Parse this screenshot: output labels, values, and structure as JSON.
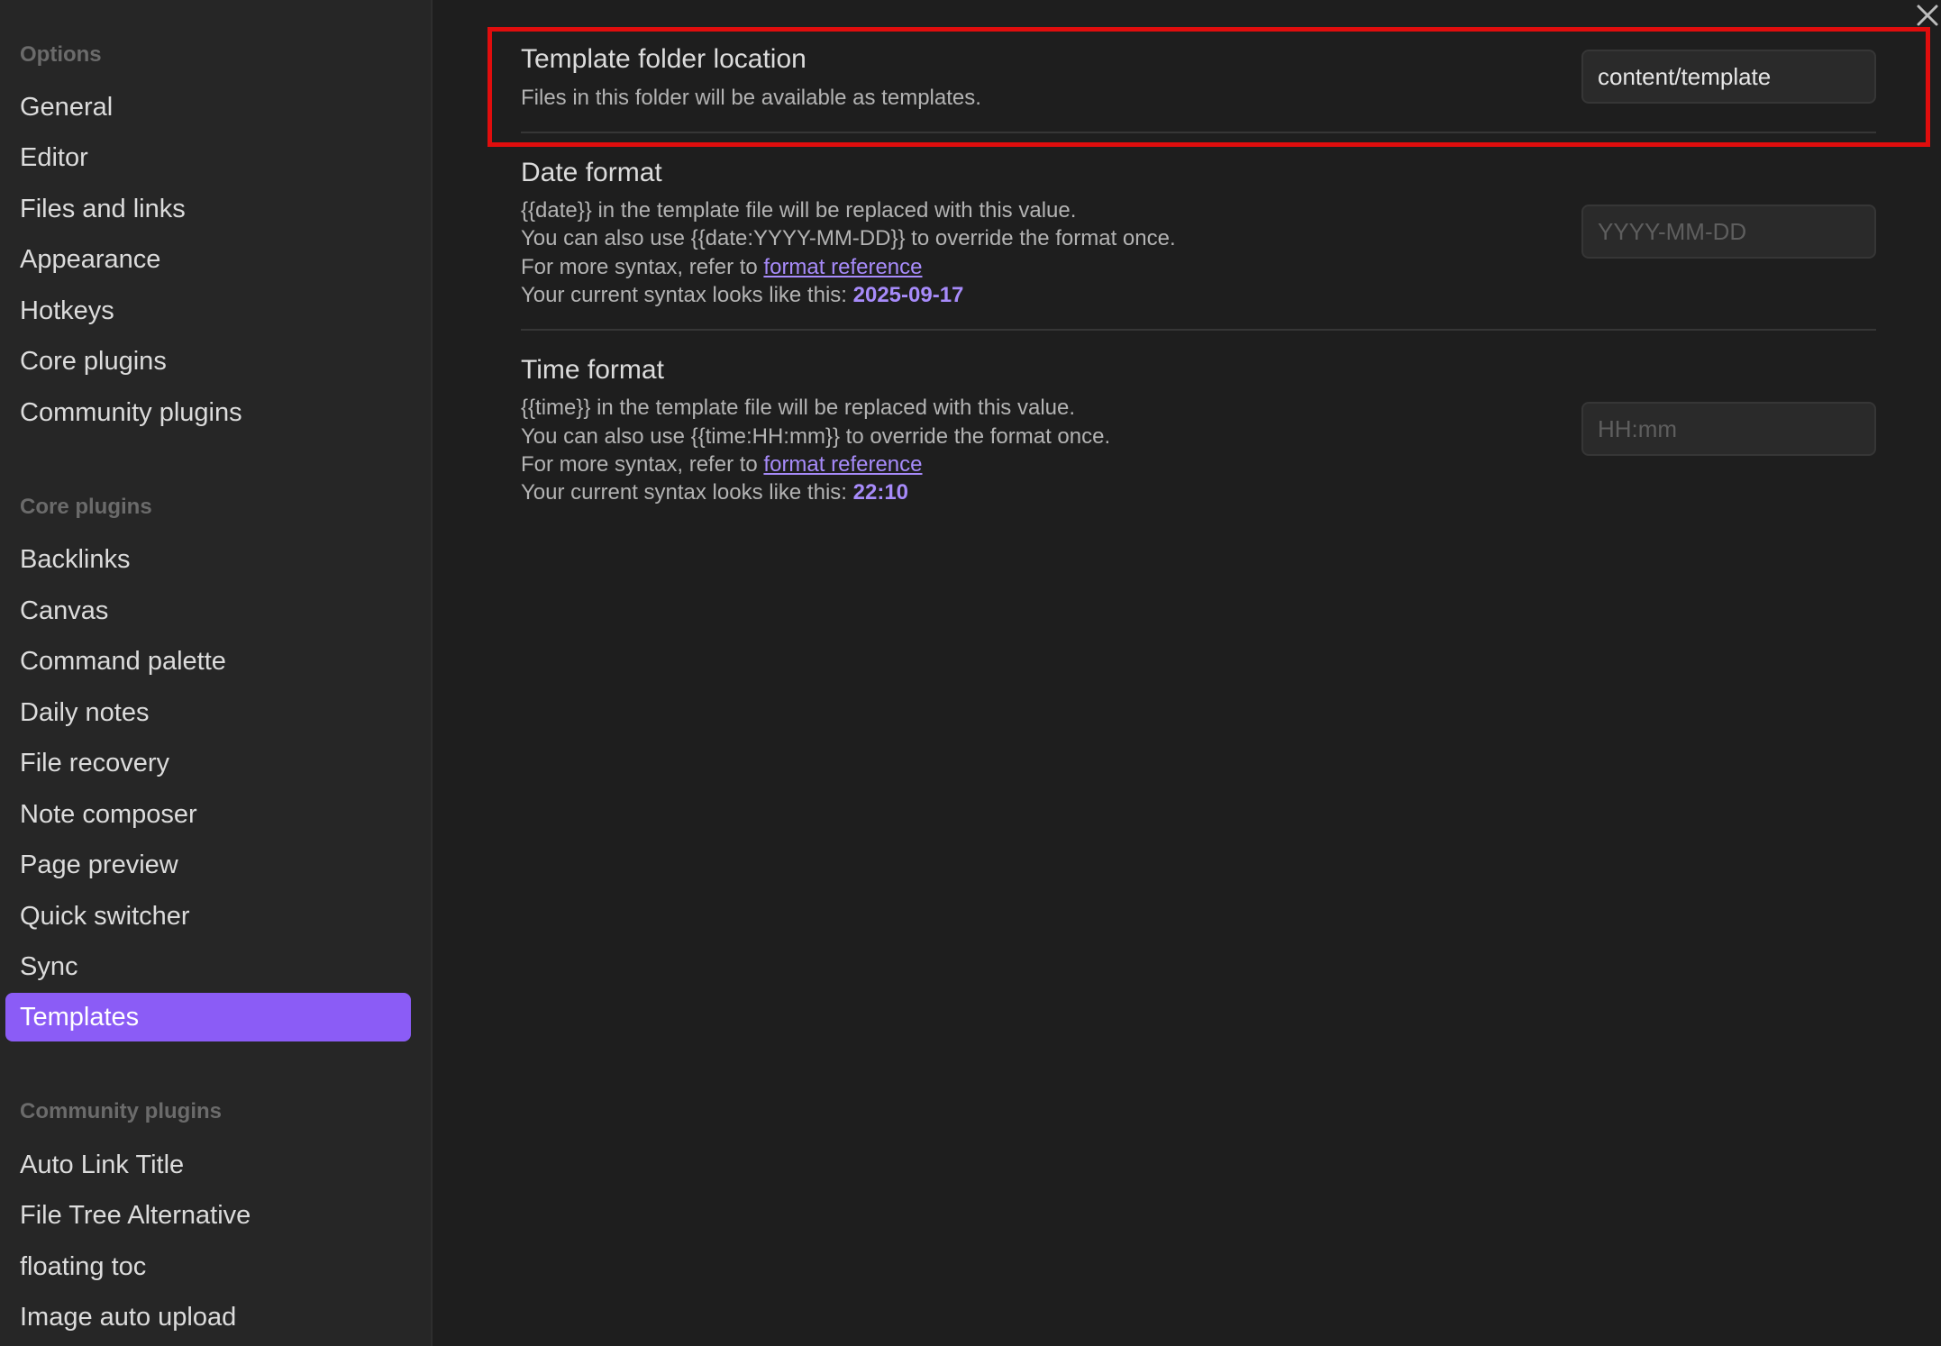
{
  "sidebar": {
    "options_heading": "Options",
    "options": [
      {
        "label": "General"
      },
      {
        "label": "Editor"
      },
      {
        "label": "Files and links"
      },
      {
        "label": "Appearance"
      },
      {
        "label": "Hotkeys"
      },
      {
        "label": "Core plugins"
      },
      {
        "label": "Community plugins"
      }
    ],
    "core_heading": "Core plugins",
    "core_plugins": [
      {
        "label": "Backlinks"
      },
      {
        "label": "Canvas"
      },
      {
        "label": "Command palette"
      },
      {
        "label": "Daily notes"
      },
      {
        "label": "File recovery"
      },
      {
        "label": "Note composer"
      },
      {
        "label": "Page preview"
      },
      {
        "label": "Quick switcher"
      },
      {
        "label": "Sync"
      },
      {
        "label": "Templates",
        "active": true
      }
    ],
    "community_heading": "Community plugins",
    "community_plugins": [
      {
        "label": "Auto Link Title"
      },
      {
        "label": "File Tree Alternative"
      },
      {
        "label": "floating toc"
      },
      {
        "label": "Image auto upload"
      }
    ]
  },
  "close_icon": "close-icon",
  "settings": {
    "template_folder": {
      "name": "Template folder location",
      "desc": "Files in this folder will be available as templates.",
      "value": "content/template",
      "placeholder": ""
    },
    "date_format": {
      "name": "Date format",
      "desc_line1": "{{date}} in the template file will be replaced with this value.",
      "desc_line2": "You can also use {{date:YYYY-MM-DD}} to override the format once.",
      "desc_line3_prefix": "For more syntax, refer to ",
      "desc_link": "format reference",
      "desc_line4_prefix": "Your current syntax looks like this: ",
      "preview": "2025-09-17",
      "value": "",
      "placeholder": "YYYY-MM-DD"
    },
    "time_format": {
      "name": "Time format",
      "desc_line1": "{{time}} in the template file will be replaced with this value.",
      "desc_line2": "You can also use {{time:HH:mm}} to override the format once.",
      "desc_line3_prefix": "For more syntax, refer to ",
      "desc_link": "format reference",
      "desc_line4_prefix": "Your current syntax looks like this: ",
      "preview": "22:10",
      "value": "",
      "placeholder": "HH:mm"
    }
  },
  "colors": {
    "accent": "#8b5cf6",
    "link": "#a78bfa",
    "highlight": "#e00d0d",
    "background": "#1e1e1e",
    "sidebar": "#262626"
  }
}
